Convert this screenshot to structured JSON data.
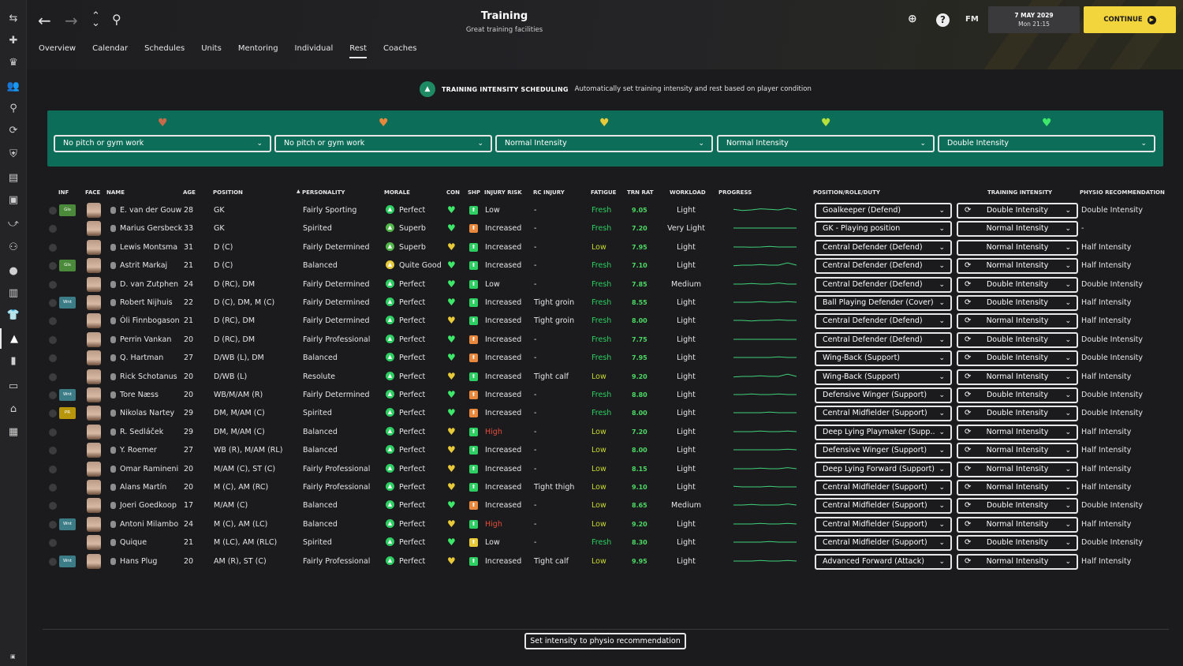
{
  "header": {
    "title": "Training",
    "subtitle": "Great training facilities",
    "date": "7 MAY 2029",
    "time": "Mon 21:15",
    "continue_label": "CONTINUE",
    "fm_label": "FM"
  },
  "tabs": [
    "Overview",
    "Calendar",
    "Schedules",
    "Units",
    "Mentoring",
    "Individual",
    "Rest",
    "Coaches"
  ],
  "active_tab": "Rest",
  "scheduling": {
    "title": "TRAINING INTENSITY SCHEDULING",
    "description": "Automatically set training intensity and rest based on player condition"
  },
  "condition_bands": [
    {
      "heart_color": "#c96a4a",
      "value": "No pitch or gym work"
    },
    {
      "heart_color": "#e9883c",
      "value": "No pitch or gym work"
    },
    {
      "heart_color": "#e8c93a",
      "value": "Normal Intensity"
    },
    {
      "heart_color": "#b7e03b",
      "value": "Normal Intensity"
    },
    {
      "heart_color": "#3ee86a",
      "value": "Double Intensity"
    }
  ],
  "columns": {
    "inf": "INF",
    "face": "FACE",
    "name": "NAME",
    "age": "AGE",
    "position": "POSITION",
    "personality": "PERSONALITY",
    "morale": "MORALE",
    "con": "CON",
    "shp": "SHP",
    "injury_risk": "INJURY RISK",
    "rc_injury": "RC INJURY",
    "fatigue": "FATIGUE",
    "trn_rat": "TRN RAT",
    "workload": "WORKLOAD",
    "progress": "PROGRESS",
    "role": "POSITION/ROLE/DUTY",
    "intensity": "TRAINING INTENSITY",
    "physio": "PHYSIO RECOMMENDATION"
  },
  "players": [
    {
      "inf": "Gls",
      "inf_color": "#4a8a3a",
      "name": "E. van der Gouw",
      "age": "28",
      "position": "GK",
      "personality": "Fairly Sporting",
      "morale": "Perfect",
      "morale_color": "#2dcf62",
      "con": "#3ee86a",
      "shp": "green",
      "risk": "Low",
      "rc": "-",
      "fatigue": "Fresh",
      "trn": "9.05",
      "workload": "Light",
      "role": "Goalkeeper (Defend)",
      "intensity": "Double Intensity",
      "sync": true,
      "physio": "Double Intensity",
      "spark": [
        0.45,
        0.55,
        0.5,
        0.4,
        0.45,
        0.5,
        0.35,
        0.5
      ]
    },
    {
      "inf": "",
      "name": "Marius Gersbeck",
      "age": "33",
      "position": "GK",
      "personality": "Spirited",
      "morale": "Superb",
      "morale_color": "#52b64a",
      "con": "#3ee86a",
      "shp": "orange",
      "risk": "Increased",
      "rc": "-",
      "fatigue": "Fresh",
      "trn": "7.20",
      "workload": "Very Light",
      "role": "GK - Playing position",
      "intensity": "Normal Intensity",
      "sync": false,
      "physio": "-",
      "spark": [
        0.5,
        0.5,
        0.5,
        0.5,
        0.5,
        0.5,
        0.5,
        0.5
      ]
    },
    {
      "inf": "",
      "name": "Lewis Montsma",
      "age": "31",
      "position": "D (C)",
      "personality": "Fairly Determined",
      "morale": "Superb",
      "morale_color": "#52b64a",
      "con": "#e8c93a",
      "shp": "green",
      "risk": "Increased",
      "rc": "-",
      "fatigue": "Low",
      "trn": "7.95",
      "workload": "Light",
      "role": "Central Defender (Defend)",
      "intensity": "Normal Intensity",
      "sync": false,
      "physio": "Half Intensity",
      "spark": [
        0.5,
        0.5,
        0.52,
        0.5,
        0.45,
        0.5,
        0.5,
        0.5
      ]
    },
    {
      "inf": "Gls",
      "inf_color": "#4a8a3a",
      "name": "Astrit Markaj",
      "age": "21",
      "position": "D (C)",
      "personality": "Balanced",
      "morale": "Quite Good",
      "morale_color": "#e8c93a",
      "con": "#3ee86a",
      "shp": "green",
      "risk": "Increased",
      "rc": "-",
      "fatigue": "Fresh",
      "trn": "7.10",
      "workload": "Light",
      "role": "Central Defender (Defend)",
      "intensity": "Normal Intensity",
      "sync": true,
      "physio": "Half Intensity",
      "spark": [
        0.55,
        0.5,
        0.5,
        0.45,
        0.5,
        0.5,
        0.3,
        0.5
      ]
    },
    {
      "inf": "",
      "name": "D. van Zutphen",
      "age": "24",
      "position": "D (RC), DM",
      "personality": "Fairly Determined",
      "morale": "Perfect",
      "morale_color": "#2dcf62",
      "con": "#3ee86a",
      "shp": "green",
      "risk": "Low",
      "rc": "-",
      "fatigue": "Fresh",
      "trn": "7.85",
      "workload": "Medium",
      "role": "Central Defender (Defend)",
      "intensity": "Double Intensity",
      "sync": true,
      "physio": "Double Intensity",
      "spark": [
        0.5,
        0.5,
        0.45,
        0.5,
        0.5,
        0.4,
        0.5,
        0.5
      ]
    },
    {
      "inf": "Wnt",
      "inf_color": "#3c7c86",
      "name": "Robert Nijhuis",
      "age": "22",
      "position": "D (C), DM, M (C)",
      "personality": "Fairly Determined",
      "morale": "Perfect",
      "morale_color": "#2dcf62",
      "con": "#3ee86a",
      "shp": "green",
      "risk": "Increased",
      "rc": "Tight groin",
      "fatigue": "Fresh",
      "trn": "8.55",
      "workload": "Light",
      "role": "Ball Playing Defender (Cover)",
      "intensity": "Double Intensity",
      "sync": true,
      "physio": "Half Intensity",
      "spark": [
        0.5,
        0.5,
        0.5,
        0.45,
        0.5,
        0.5,
        0.45,
        0.5
      ]
    },
    {
      "inf": "",
      "name": "Óli Finnbogason",
      "age": "21",
      "position": "D (RC), DM",
      "personality": "Fairly Determined",
      "morale": "Perfect",
      "morale_color": "#2dcf62",
      "con": "#e8c93a",
      "shp": "green",
      "risk": "Increased",
      "rc": "Tight groin",
      "fatigue": "Fresh",
      "trn": "8.00",
      "workload": "Light",
      "role": "Central Defender (Defend)",
      "intensity": "Normal Intensity",
      "sync": true,
      "physio": "Half Intensity",
      "spark": [
        0.5,
        0.5,
        0.55,
        0.5,
        0.5,
        0.45,
        0.5,
        0.5
      ]
    },
    {
      "inf": "",
      "name": "Perrin Vankan",
      "age": "20",
      "position": "D (RC), DM",
      "personality": "Fairly Professional",
      "morale": "Perfect",
      "morale_color": "#2dcf62",
      "con": "#3ee86a",
      "shp": "orange",
      "risk": "Increased",
      "rc": "-",
      "fatigue": "Fresh",
      "trn": "7.75",
      "workload": "Light",
      "role": "Central Defender (Defend)",
      "intensity": "Double Intensity",
      "sync": true,
      "physio": "Double Intensity",
      "spark": [
        0.5,
        0.5,
        0.5,
        0.5,
        0.5,
        0.5,
        0.5,
        0.5
      ]
    },
    {
      "inf": "",
      "name": "Q. Hartman",
      "age": "27",
      "position": "D/WB (L), DM",
      "personality": "Balanced",
      "morale": "Perfect",
      "morale_color": "#2dcf62",
      "con": "#3ee86a",
      "shp": "orange",
      "risk": "Increased",
      "rc": "-",
      "fatigue": "Fresh",
      "trn": "7.95",
      "workload": "Light",
      "role": "Wing-Back (Support)",
      "intensity": "Double Intensity",
      "sync": true,
      "physio": "Double Intensity",
      "spark": [
        0.5,
        0.5,
        0.5,
        0.5,
        0.5,
        0.45,
        0.5,
        0.5
      ]
    },
    {
      "inf": "",
      "name": "Rick Schotanus",
      "age": "20",
      "position": "D/WB (L)",
      "personality": "Resolute",
      "morale": "Perfect",
      "morale_color": "#2dcf62",
      "con": "#e8c93a",
      "shp": "green",
      "risk": "Increased",
      "rc": "Tight calf",
      "fatigue": "Low",
      "trn": "9.20",
      "workload": "Light",
      "role": "Wing-Back (Support)",
      "intensity": "Normal Intensity",
      "sync": true,
      "physio": "Half Intensity",
      "spark": [
        0.55,
        0.5,
        0.5,
        0.45,
        0.5,
        0.5,
        0.3,
        0.5
      ]
    },
    {
      "inf": "Wnt",
      "inf_color": "#3c7c86",
      "name": "Tore Næss",
      "age": "20",
      "position": "WB/M/AM (R)",
      "personality": "Fairly Determined",
      "morale": "Perfect",
      "morale_color": "#2dcf62",
      "con": "#3ee86a",
      "shp": "orange",
      "risk": "Increased",
      "rc": "-",
      "fatigue": "Fresh",
      "trn": "8.80",
      "workload": "Light",
      "role": "Defensive Winger (Support)",
      "intensity": "Double Intensity",
      "sync": true,
      "physio": "Double Intensity",
      "spark": [
        0.5,
        0.5,
        0.45,
        0.5,
        0.5,
        0.45,
        0.5,
        0.5
      ]
    },
    {
      "inf": "PR",
      "inf_color": "#b8960c",
      "name": "Nikolas Nartey",
      "age": "29",
      "position": "DM, M/AM (C)",
      "personality": "Spirited",
      "morale": "Perfect",
      "morale_color": "#2dcf62",
      "con": "#3ee86a",
      "shp": "orange",
      "risk": "Increased",
      "rc": "-",
      "fatigue": "Fresh",
      "trn": "8.00",
      "workload": "Light",
      "role": "Central Midfielder (Support)",
      "intensity": "Double Intensity",
      "sync": true,
      "physio": "Double Intensity",
      "spark": [
        0.5,
        0.5,
        0.5,
        0.5,
        0.45,
        0.5,
        0.5,
        0.5
      ]
    },
    {
      "inf": "",
      "name": "R. Sedláček",
      "age": "29",
      "position": "DM, M/AM (C)",
      "personality": "Balanced",
      "morale": "Perfect",
      "morale_color": "#2dcf62",
      "con": "#e8c93a",
      "shp": "green",
      "risk": "High",
      "rc": "-",
      "fatigue": "Low",
      "trn": "7.20",
      "workload": "Light",
      "role": "Deep Lying Playmaker (Supp...",
      "intensity": "Normal Intensity",
      "sync": true,
      "physio": "Half Intensity",
      "spark": [
        0.5,
        0.5,
        0.5,
        0.45,
        0.5,
        0.5,
        0.45,
        0.5
      ]
    },
    {
      "inf": "",
      "name": "Y. Roemer",
      "age": "27",
      "position": "WB (R), M/AM (RL)",
      "personality": "Balanced",
      "morale": "Perfect",
      "morale_color": "#2dcf62",
      "con": "#e8c93a",
      "shp": "green",
      "risk": "Increased",
      "rc": "-",
      "fatigue": "Low",
      "trn": "8.00",
      "workload": "Light",
      "role": "Defensive Winger (Support)",
      "intensity": "Normal Intensity",
      "sync": true,
      "physio": "Half Intensity",
      "spark": [
        0.5,
        0.5,
        0.5,
        0.5,
        0.5,
        0.5,
        0.45,
        0.5
      ]
    },
    {
      "inf": "",
      "name": "Omar Ramineni",
      "age": "20",
      "position": "M/AM (C), ST (C)",
      "personality": "Fairly Professional",
      "morale": "Perfect",
      "morale_color": "#2dcf62",
      "con": "#e8c93a",
      "shp": "green",
      "risk": "Increased",
      "rc": "-",
      "fatigue": "Low",
      "trn": "8.15",
      "workload": "Light",
      "role": "Deep Lying Forward (Support)",
      "intensity": "Normal Intensity",
      "sync": true,
      "physio": "Half Intensity",
      "spark": [
        0.5,
        0.5,
        0.5,
        0.45,
        0.5,
        0.5,
        0.4,
        0.5
      ]
    },
    {
      "inf": "",
      "name": "Alans Martín",
      "age": "20",
      "position": "M (C), AM (RC)",
      "personality": "Fairly Professional",
      "morale": "Perfect",
      "morale_color": "#2dcf62",
      "con": "#e8c93a",
      "shp": "green",
      "risk": "Increased",
      "rc": "Tight thigh",
      "fatigue": "Low",
      "trn": "9.10",
      "workload": "Light",
      "role": "Central Midfielder (Support)",
      "intensity": "Normal Intensity",
      "sync": true,
      "physio": "Half Intensity",
      "spark": [
        0.45,
        0.5,
        0.5,
        0.5,
        0.45,
        0.5,
        0.5,
        0.5
      ]
    },
    {
      "inf": "",
      "name": "Joeri Goedkoop",
      "age": "17",
      "position": "M/AM (C)",
      "personality": "Balanced",
      "morale": "Perfect",
      "morale_color": "#2dcf62",
      "con": "#3ee86a",
      "shp": "orange",
      "risk": "Increased",
      "rc": "-",
      "fatigue": "Low",
      "trn": "8.65",
      "workload": "Medium",
      "role": "Central Midfielder (Support)",
      "intensity": "Double Intensity",
      "sync": true,
      "physio": "Double Intensity",
      "spark": [
        0.5,
        0.5,
        0.45,
        0.5,
        0.5,
        0.5,
        0.4,
        0.5
      ]
    },
    {
      "inf": "Wnt",
      "inf_color": "#3c7c86",
      "name": "Antoni Milambo",
      "age": "24",
      "position": "M (C), AM (LC)",
      "personality": "Balanced",
      "morale": "Perfect",
      "morale_color": "#2dcf62",
      "con": "#e8c93a",
      "shp": "green",
      "risk": "High",
      "rc": "-",
      "fatigue": "Low",
      "trn": "9.20",
      "workload": "Light",
      "role": "Central Midfielder (Support)",
      "intensity": "Normal Intensity",
      "sync": true,
      "physio": "Half Intensity",
      "spark": [
        0.5,
        0.5,
        0.5,
        0.45,
        0.5,
        0.5,
        0.45,
        0.5
      ]
    },
    {
      "inf": "",
      "name": "Quique",
      "age": "21",
      "position": "M (LC), AM (RLC)",
      "personality": "Spirited",
      "morale": "Perfect",
      "morale_color": "#2dcf62",
      "con": "#3ee86a",
      "shp": "yellow",
      "risk": "Low",
      "rc": "-",
      "fatigue": "Fresh",
      "trn": "8.30",
      "workload": "Light",
      "role": "Central Midfielder (Support)",
      "intensity": "Double Intensity",
      "sync": true,
      "physio": "Double Intensity",
      "spark": [
        0.5,
        0.5,
        0.5,
        0.5,
        0.45,
        0.5,
        0.5,
        0.5
      ]
    },
    {
      "inf": "Wnt",
      "inf_color": "#3c7c86",
      "name": "Hans Plug",
      "age": "20",
      "position": "AM (R), ST (C)",
      "personality": "Fairly Professional",
      "morale": "Perfect",
      "morale_color": "#2dcf62",
      "con": "#e8c93a",
      "shp": "green",
      "risk": "Increased",
      "rc": "Tight calf",
      "fatigue": "Low",
      "trn": "9.95",
      "workload": "Light",
      "role": "Advanced Forward (Attack)",
      "intensity": "Normal Intensity",
      "sync": true,
      "physio": "Half Intensity",
      "spark": [
        0.5,
        0.5,
        0.5,
        0.45,
        0.5,
        0.5,
        0.45,
        0.5
      ]
    }
  ],
  "footer": {
    "physio_button": "Set intensity to physio recommendation"
  },
  "colors": {
    "accent": "#f2d43d",
    "panel": "#0c6e58",
    "fresh": "#2dcf62",
    "low": "#c8d834",
    "high": "#e84b3c"
  }
}
